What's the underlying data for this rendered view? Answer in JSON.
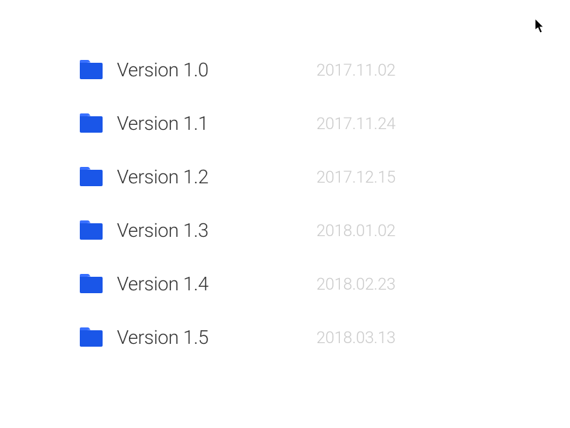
{
  "folders": [
    {
      "label": "Version 1.0",
      "date": "2017.11.02"
    },
    {
      "label": "Version 1.1",
      "date": "2017.11.24"
    },
    {
      "label": "Version 1.2",
      "date": "2017.12.15"
    },
    {
      "label": "Version 1.3",
      "date": "2018.01.02"
    },
    {
      "label": "Version 1.4",
      "date": "2018.02.23"
    },
    {
      "label": "Version 1.5",
      "date": "2018.03.13"
    }
  ],
  "colors": {
    "folder_body": "#1a56e8",
    "folder_tab": "#3970ff",
    "text_primary": "#333333",
    "text_muted": "#c9c9c9"
  }
}
